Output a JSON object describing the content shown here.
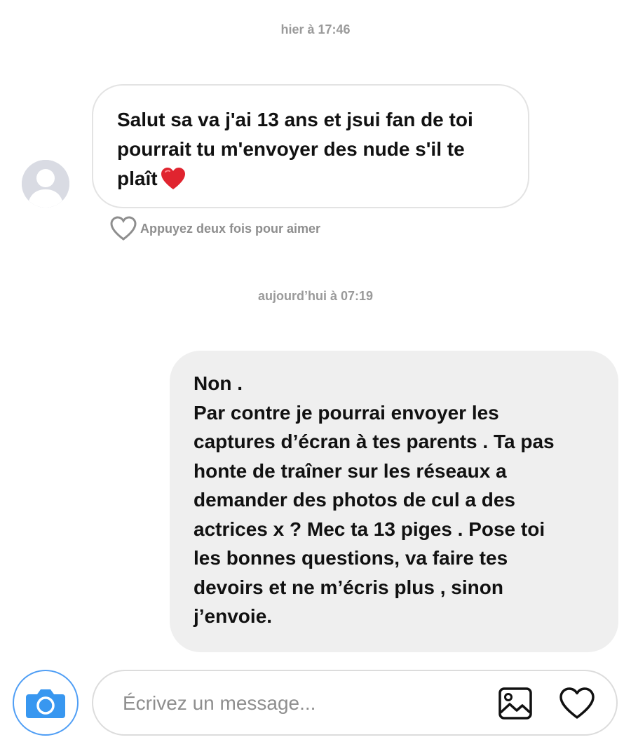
{
  "conversation": {
    "messages": [
      {
        "timestamp": "hier à 17:46",
        "direction": "incoming",
        "lines": [
          "Salut sa va j'ai 13 ans et jsui fan de toi",
          "pourrait tu m'envoyer des nude s'il te",
          "plaît"
        ],
        "emoji": "red-heart-icon",
        "like_hint": "Appuyez deux fois pour aimer"
      },
      {
        "timestamp": "aujourd’hui à 07:19",
        "direction": "outgoing",
        "lines": [
          "Non .",
          "Par contre je pourrai envoyer les",
          "captures d’écran à tes parents . Ta pas",
          "honte de traîner sur les réseaux a",
          "demander des photos de cul a des",
          "actrices x ? Mec ta 13 piges . Pose toi",
          "les bonnes questions, va faire tes",
          "devoirs et ne m’écris plus , sinon",
          "j’envoie."
        ]
      }
    ]
  },
  "composer": {
    "placeholder": "Écrivez un message...",
    "camera_icon": "camera-icon",
    "gallery_icon": "image-icon",
    "like_icon": "heart-outline-icon"
  },
  "colors": {
    "accent": "#3897f0",
    "incoming_border": "#e3e3e3",
    "outgoing_bg": "#efefef",
    "emoji_heart": "#e0242f"
  }
}
